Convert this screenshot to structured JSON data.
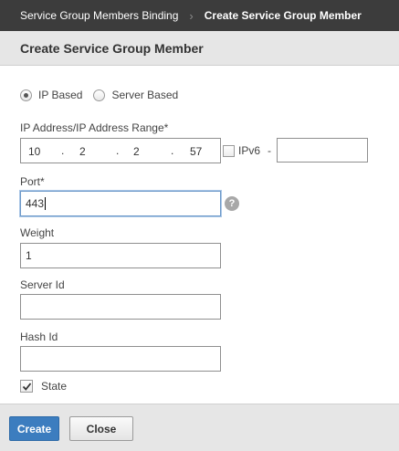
{
  "breadcrumb": {
    "parent": "Service Group Members Binding",
    "current": "Create Service Group Member"
  },
  "dialog": {
    "title": "Create Service Group Member"
  },
  "mode": {
    "options": [
      "IP Based",
      "Server Based"
    ],
    "selected": "IP Based"
  },
  "ip": {
    "label": "IP Address/IP Address Range*",
    "octets": [
      "10",
      "2",
      "2",
      "57"
    ],
    "ipv6_label": "IPv6",
    "ipv6_checked": false,
    "range_separator": "-",
    "range_end": ""
  },
  "port": {
    "label": "Port*",
    "value": "443",
    "help_icon": "?"
  },
  "weight": {
    "label": "Weight",
    "value": "1"
  },
  "server_id": {
    "label": "Server Id",
    "value": ""
  },
  "hash_id": {
    "label": "Hash Id",
    "value": ""
  },
  "state": {
    "label": "State",
    "checked": true
  },
  "buttons": {
    "create": "Create",
    "close": "Close"
  },
  "colors": {
    "topbar": "#3c3c3c",
    "primary_button": "#3c7dbf",
    "panel_gray": "#e6e6e6"
  }
}
